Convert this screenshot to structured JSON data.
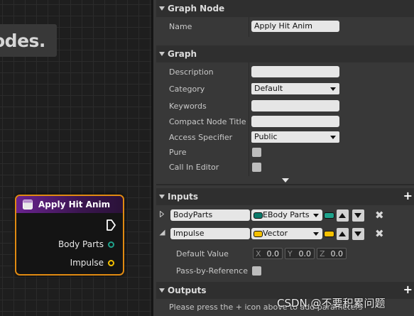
{
  "canvas": {
    "comment_text": "odes.",
    "node": {
      "title": "Apply Hit Anim",
      "pins": [
        {
          "label": "Body Parts",
          "color": "#1fa38c"
        },
        {
          "label": "Impulse",
          "color": "#f5c000"
        }
      ],
      "border_color": "#e08a12"
    }
  },
  "panel": {
    "graph_node": {
      "header": "Graph Node",
      "name_label": "Name",
      "name_value": "Apply Hit Anim"
    },
    "graph": {
      "header": "Graph",
      "description_label": "Description",
      "description_value": "",
      "category_label": "Category",
      "category_value": "Default",
      "keywords_label": "Keywords",
      "keywords_value": "",
      "compact_title_label": "Compact Node Title",
      "compact_title_value": "",
      "access_label": "Access Specifier",
      "access_value": "Public",
      "pure_label": "Pure",
      "call_in_editor_label": "Call In Editor"
    },
    "inputs": {
      "header": "Inputs",
      "params": [
        {
          "name": "BodyParts",
          "type": "EBody Parts",
          "type_color": "#0a7a6a",
          "expanded": false
        },
        {
          "name": "Impulse",
          "type": "Vector",
          "type_color": "#f5c000",
          "expanded": true
        }
      ],
      "default_value_label": "Default Value",
      "default_value": {
        "x_label": "X",
        "x": "0.0",
        "y_label": "Y",
        "y": "0.0",
        "z_label": "Z",
        "z": "0.0"
      },
      "pass_by_ref_label": "Pass-by-Reference"
    },
    "outputs": {
      "header": "Outputs",
      "hint": "Please press the + icon above to add parameters"
    }
  },
  "watermark": "CSDN @不要积累问题"
}
